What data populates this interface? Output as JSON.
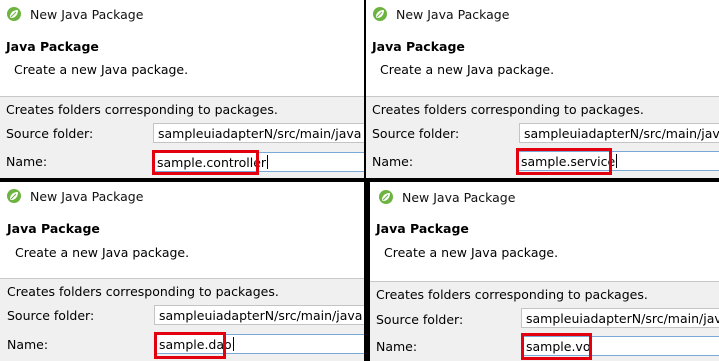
{
  "panels": [
    {
      "title": "New Java Package",
      "heading": "Java Package",
      "description": "Create a new Java package.",
      "hint": "Creates folders corresponding to packages.",
      "source_label": "Source folder:",
      "source_value": "sampleuiadapterN/src/main/java",
      "name_label": "Name:",
      "name_value": "sample.controller"
    },
    {
      "title": "New Java Package",
      "heading": "Java Package",
      "description": "Create a new Java package.",
      "hint": "Creates folders corresponding to packages.",
      "source_label": "Source folder:",
      "source_value": "sampleuiadapterN/src/main/java",
      "name_label": "Name:",
      "name_value": "sample.service"
    },
    {
      "title": "New Java Package",
      "heading": "Java Package",
      "description": "Create a new Java package.",
      "hint": "Creates folders corresponding to packages.",
      "source_label": "Source folder:",
      "source_value": "sampleuiadapterN/src/main/java",
      "name_label": "Name:",
      "name_value": "sample.dao"
    },
    {
      "title": "New Java Package",
      "heading": "Java Package",
      "description": "Create a new Java package.",
      "hint": "Creates folders corresponding to packages.",
      "source_label": "Source folder:",
      "source_value": "sampleuiadapterN/src/main/java",
      "name_label": "Name:",
      "name_value": "sample.vo"
    }
  ],
  "colors": {
    "highlight": "#e3000f",
    "dialog_bg": "#f0f0f0",
    "logo_green": "#6db33f"
  },
  "icons": {
    "title_icon": "spring-leaf-icon"
  }
}
